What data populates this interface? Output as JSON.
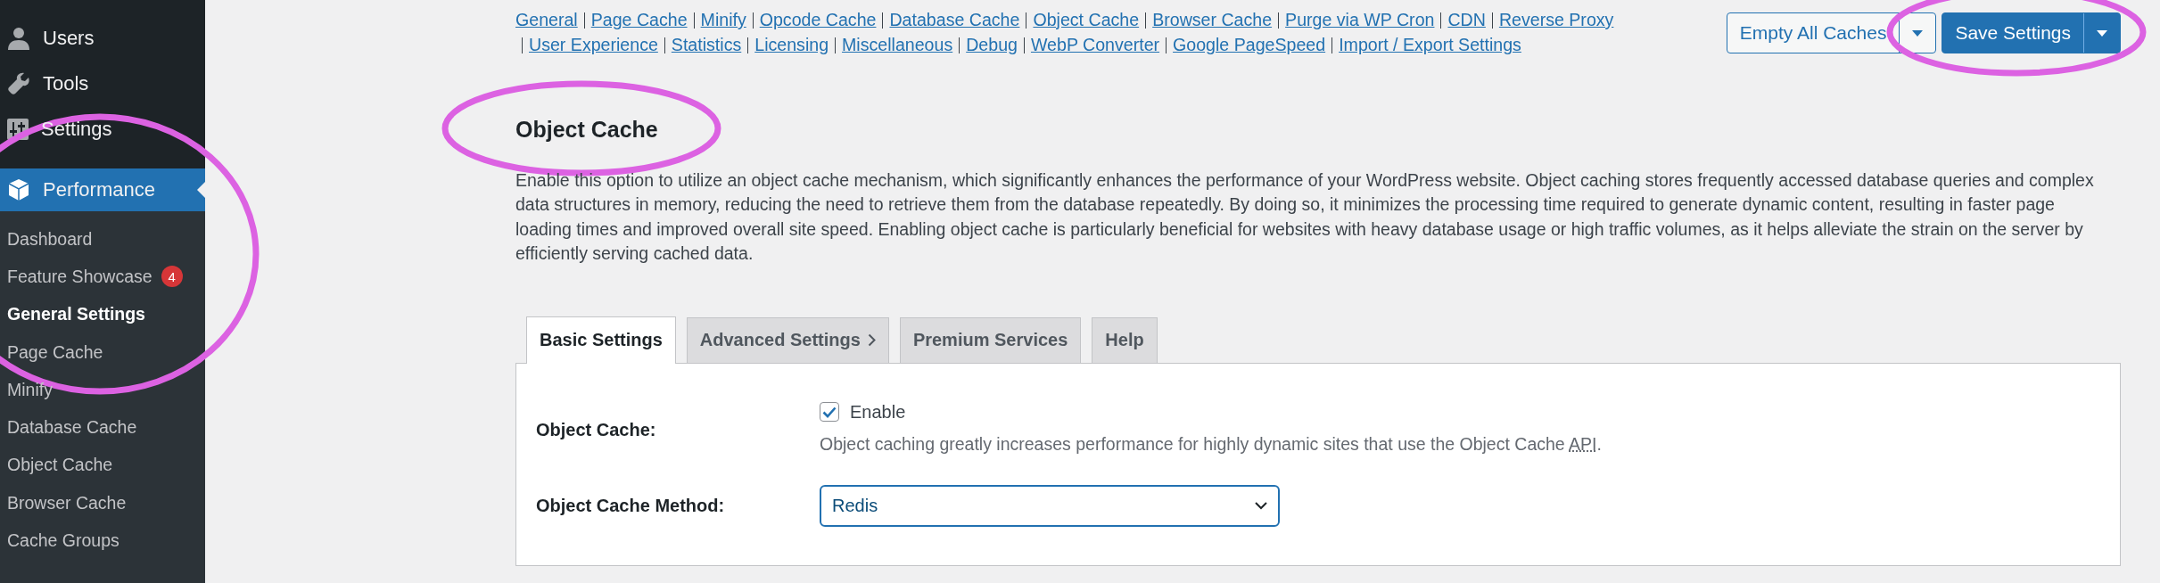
{
  "sidebar": {
    "menu": [
      {
        "label": "Users",
        "selected": false
      },
      {
        "label": "Tools",
        "selected": false
      },
      {
        "label": "Settings",
        "selected": false
      },
      {
        "label": "Performance",
        "selected": true
      }
    ],
    "submenu": [
      {
        "label": "Dashboard",
        "selected": false
      },
      {
        "label": "Feature Showcase",
        "badge": "4",
        "selected": false
      },
      {
        "label": "General Settings",
        "selected": true
      },
      {
        "label": "Page Cache",
        "selected": false
      },
      {
        "label": "Minify",
        "selected": false
      },
      {
        "label": "Database Cache",
        "selected": false
      },
      {
        "label": "Object Cache",
        "selected": false
      },
      {
        "label": "Browser Cache",
        "selected": false
      },
      {
        "label": "Cache Groups",
        "selected": false
      }
    ]
  },
  "nav_links": [
    "General",
    "Page Cache",
    "Minify",
    "Opcode Cache",
    "Database Cache",
    "Object Cache",
    "Browser Cache",
    "Purge via WP Cron",
    "CDN",
    "Reverse Proxy",
    "User Experience",
    "Statistics",
    "Licensing",
    "Miscellaneous",
    "Debug",
    "WebP Converter",
    "Google PageSpeed",
    "Import / Export Settings"
  ],
  "header_actions": [
    {
      "label": "Empty All Caches",
      "kind": "secondary"
    },
    {
      "label": "Save Settings",
      "kind": "primary"
    }
  ],
  "page": {
    "title": "Object Cache",
    "description": "Enable this option to utilize an object cache mechanism, which significantly enhances the performance of your WordPress website. Object caching stores frequently accessed database queries and complex data structures in memory, reducing the need to retrieve them from the database repeatedly. By doing so, it minimizes the processing time required to generate dynamic content, resulting in faster page loading times and improved overall site speed. Enabling object cache is particularly beneficial for websites with heavy database usage or high traffic volumes, as it helps alleviate the strain on the server by efficiently serving cached data."
  },
  "tabs": [
    {
      "label": "Basic Settings",
      "selected": true,
      "chevron": false
    },
    {
      "label": "Advanced Settings",
      "selected": false,
      "chevron": true
    },
    {
      "label": "Premium Services",
      "selected": false,
      "chevron": false
    },
    {
      "label": "Help",
      "selected": false,
      "chevron": false
    }
  ],
  "settings": [
    {
      "kind": "checkbox",
      "label": "Object Cache:",
      "option": "Enable",
      "checked": true,
      "help": "Object caching greatly increases performance for highly dynamic sites that use the Object Cache ",
      "help_abbr": "API",
      "help_end": "."
    },
    {
      "kind": "select",
      "label": "Object Cache Method:",
      "value": "Redis"
    }
  ],
  "highlights": [
    {
      "kind": "ellipse"
    },
    {
      "kind": "ellipse"
    },
    {
      "kind": "ellipse"
    }
  ]
}
